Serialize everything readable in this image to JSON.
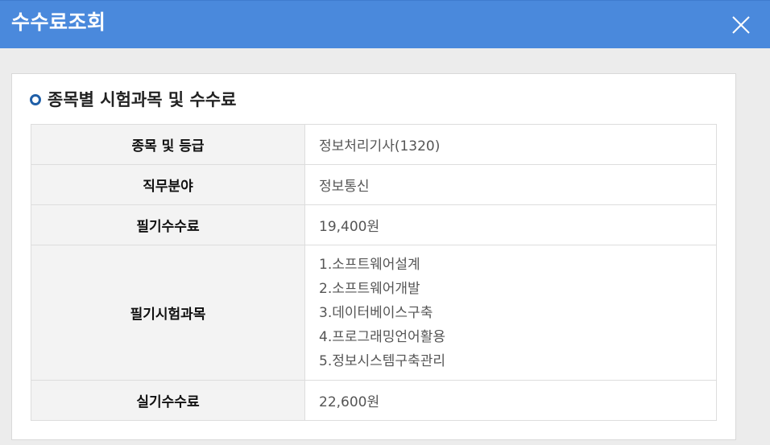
{
  "header": {
    "title": "수수료조회",
    "close_icon": "close-icon"
  },
  "section": {
    "title": "종목별 시험과목 및 수수료",
    "bullet_icon": "circle-bullet-icon"
  },
  "table": {
    "rows": [
      {
        "label": "종목 및 등급",
        "value": "정보처리기사(1320)"
      },
      {
        "label": "직무분야",
        "value": "정보통신"
      },
      {
        "label": "필기수수료",
        "value": "19,400원"
      },
      {
        "label": "필기시험과목",
        "subjects": [
          "1.소프트웨어설계",
          "2.소프트웨어개발",
          "3.데이터베이스구축",
          "4.프로그래밍언어활용",
          "5.정보시스템구축관리"
        ]
      },
      {
        "label": "실기수수료",
        "value": "22,600원"
      }
    ]
  },
  "colors": {
    "header_bg": "#4a89dc",
    "page_bg": "#ececec",
    "label_bg": "#f3f3f3",
    "bullet": "#1f5fa8"
  }
}
